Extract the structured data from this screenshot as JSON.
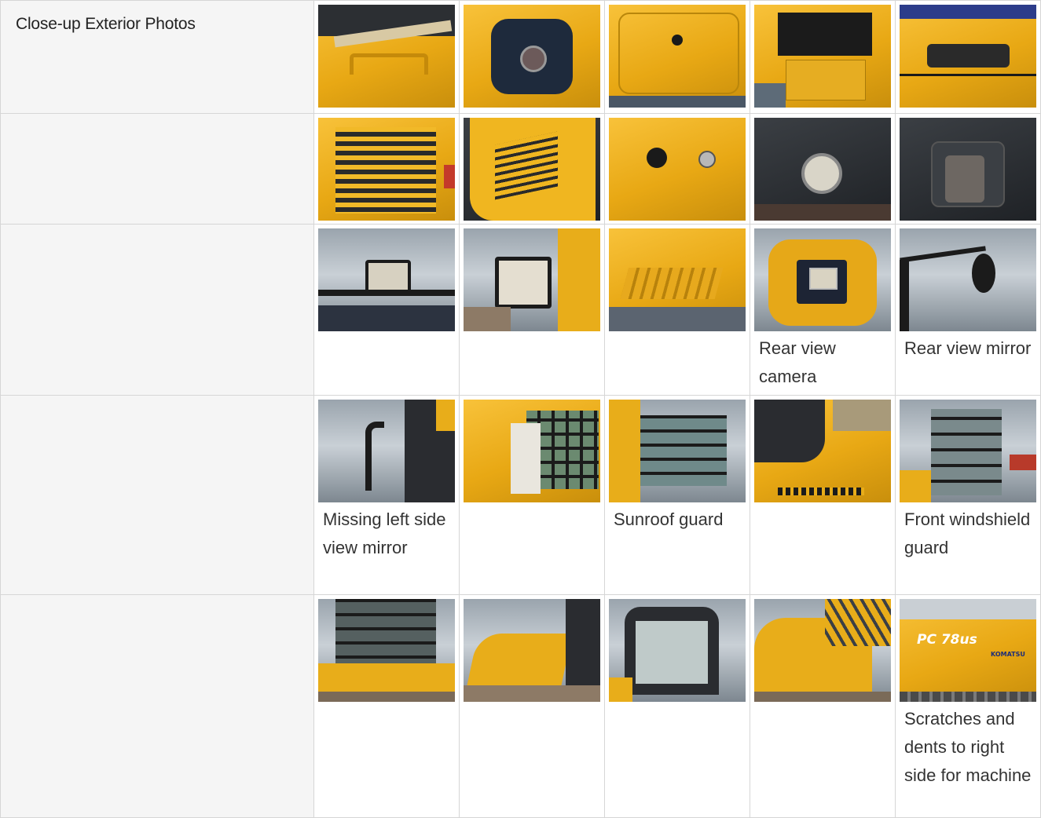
{
  "section": {
    "title": "Close-up Exterior Photos"
  },
  "rows": [
    {
      "captions": [
        "",
        "",
        "",
        "",
        ""
      ]
    },
    {
      "captions": [
        "",
        "",
        "",
        "",
        ""
      ]
    },
    {
      "captions": [
        "",
        "",
        "",
        "Rear view camera",
        "Rear view mirror"
      ]
    },
    {
      "captions": [
        "Missing left side view mirror",
        "",
        "Sunroof guard",
        "",
        "Front windshield guard"
      ]
    },
    {
      "captions": [
        "",
        "",
        "",
        "",
        "Scratches and dents to right side for machine"
      ]
    }
  ],
  "photo_icons": [
    [
      "handle-photo",
      "fuel-cap-photo",
      "access-panel-photo",
      "open-compartment-photo",
      "door-latch-photo"
    ],
    [
      "grille-photo",
      "side-vent-photo",
      "panel-lock-photo",
      "lock-cylinder-photo",
      "cab-handle-photo"
    ],
    [
      "work-light-photo",
      "boom-light-photo",
      "step-tray-photo",
      "rear-camera-photo",
      "mirror-photo"
    ],
    [
      "mirror-mount-photo",
      "cab-roof-photo",
      "sunroof-guard-photo",
      "engine-hood-photo",
      "windshield-guard-photo"
    ],
    [
      "cab-rear-photo",
      "counterweight-photo",
      "cab-front-photo",
      "side-panel-photo",
      "machine-side-photo"
    ]
  ],
  "branding": {
    "model_text": "PC 78us",
    "maker_text": "KOMATSU"
  }
}
